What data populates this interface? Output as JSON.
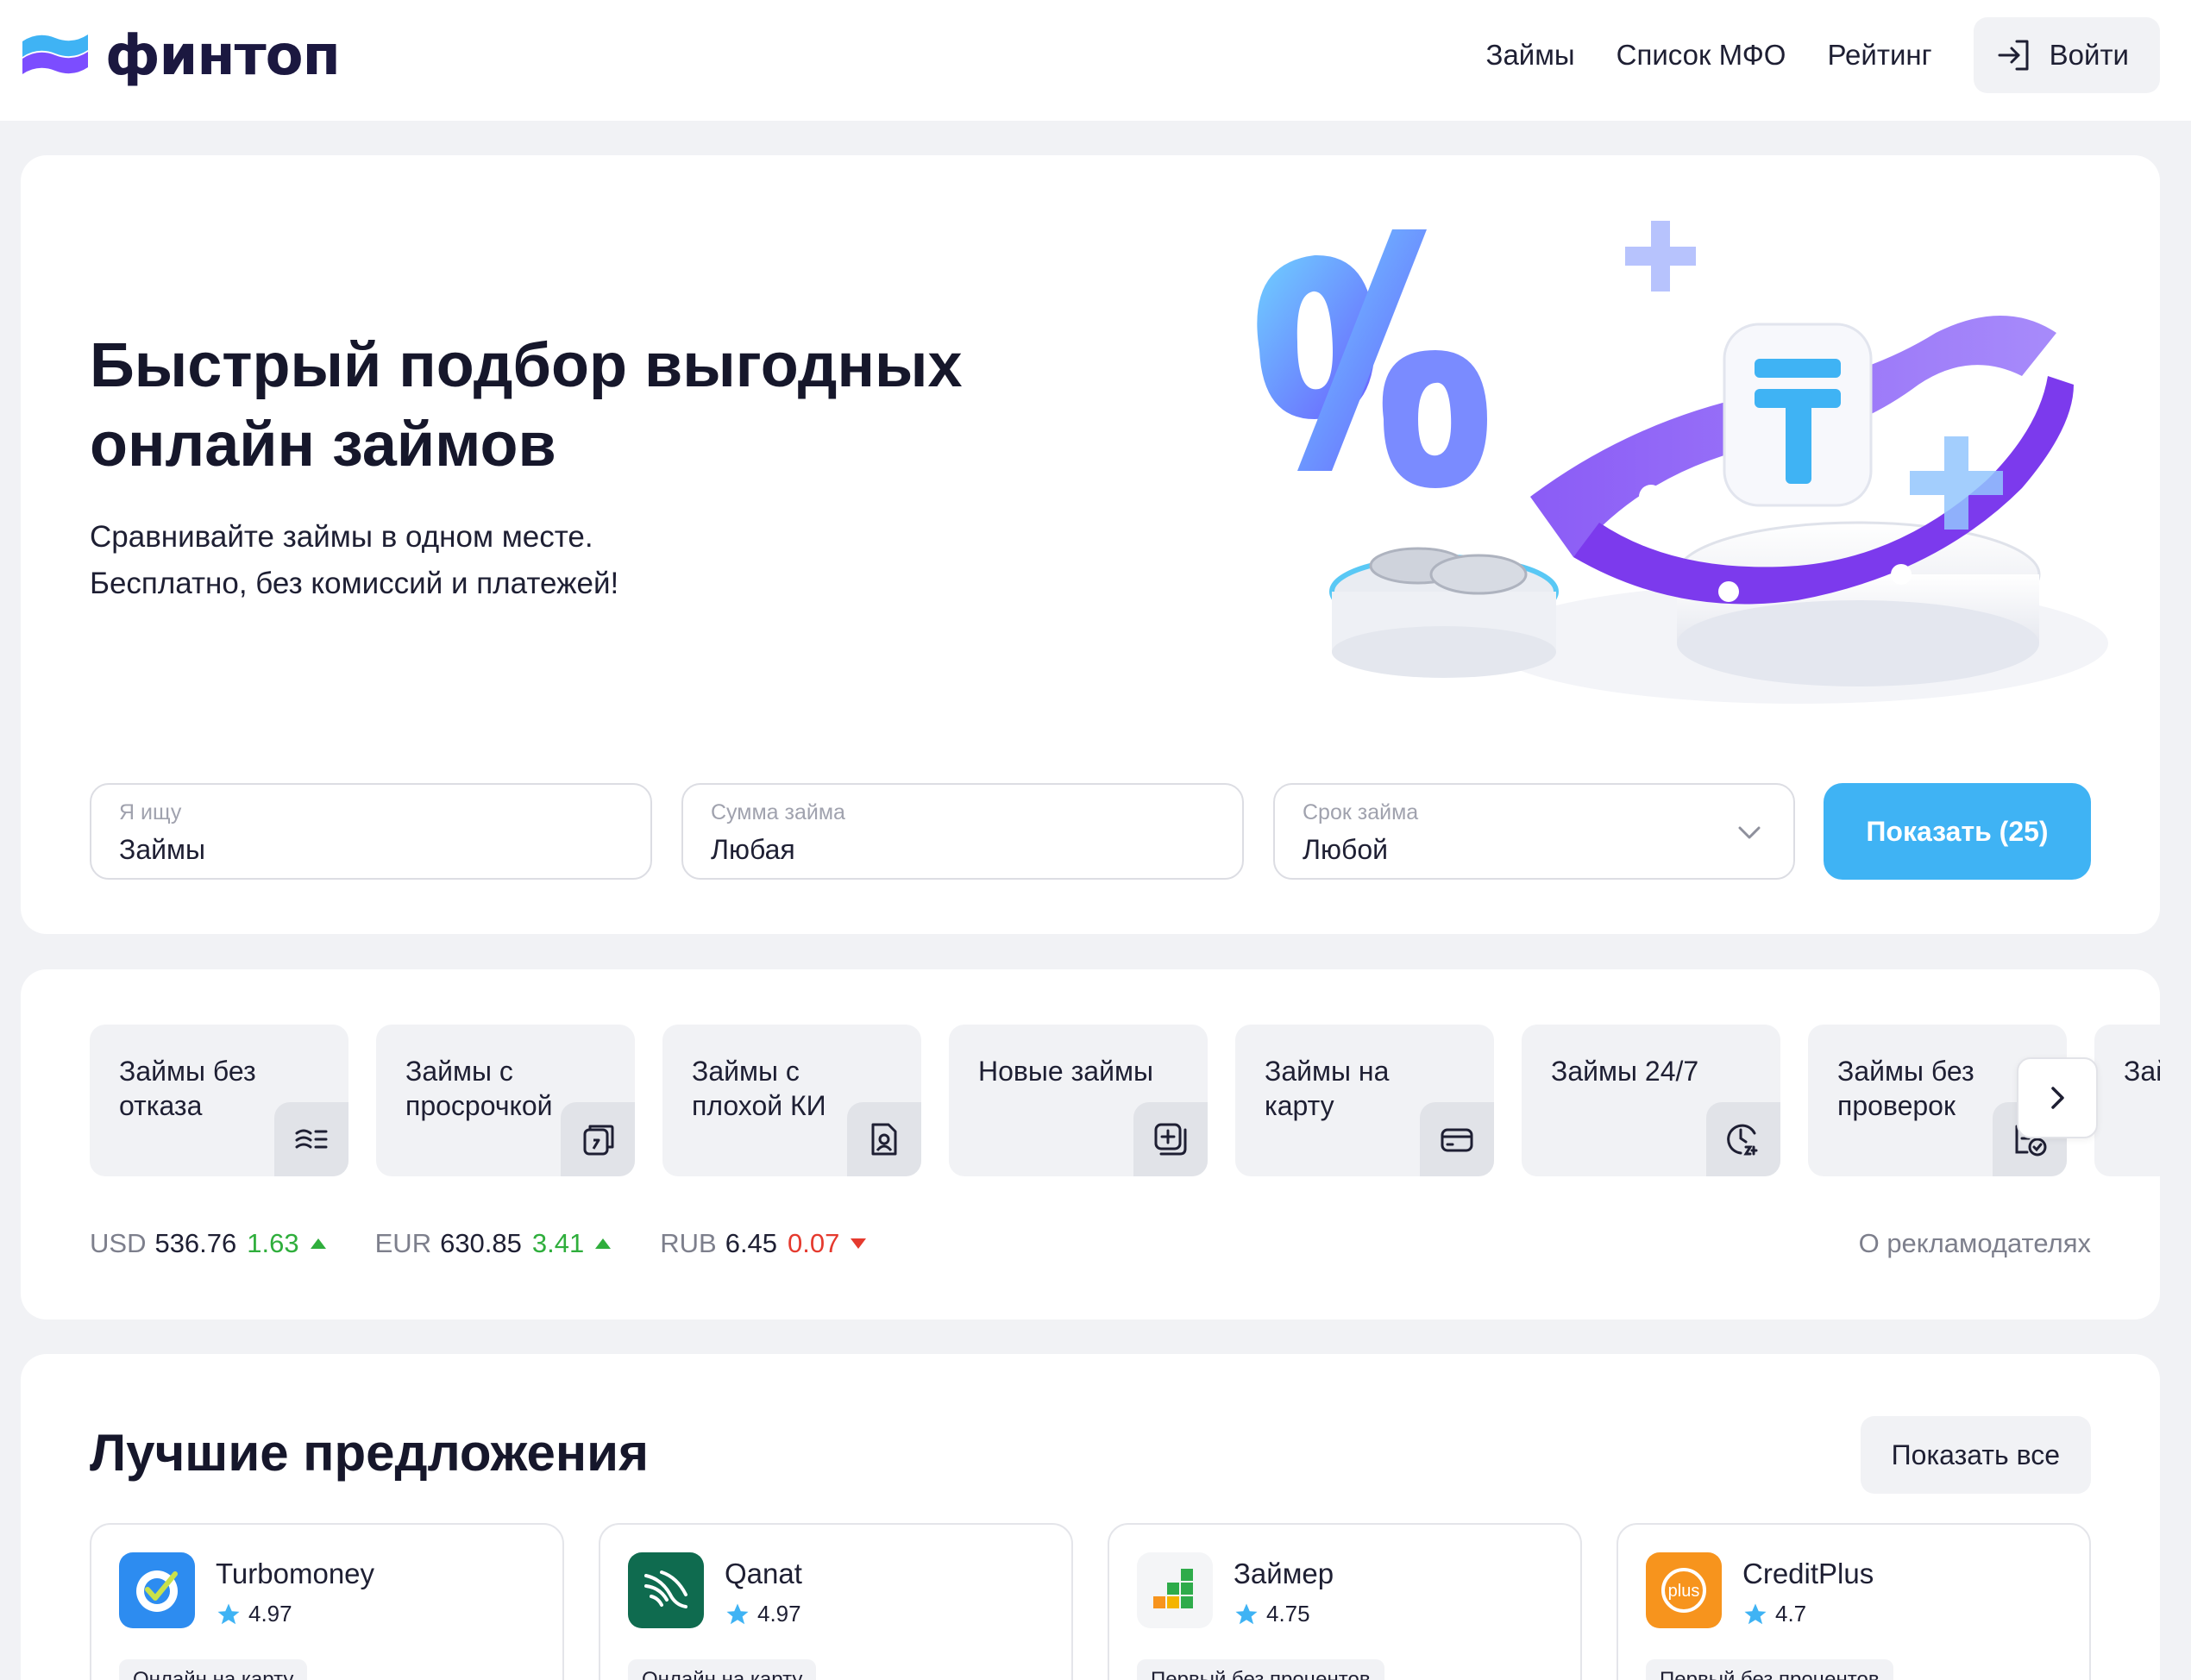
{
  "brand": {
    "name": "финтоп",
    "accent": "#3fb3f4",
    "logo_colors": [
      "#3fb3f4",
      "#7c4dff"
    ]
  },
  "nav": {
    "items": [
      "Займы",
      "Список МФО",
      "Рейтинг"
    ],
    "login": "Войти"
  },
  "hero": {
    "title": "Быстрый подбор выгодных онлайн займов",
    "subtitle_line1": "Сравнивайте займы в одном месте.",
    "subtitle_line2": "Бесплатно, без комиссий и платежей!"
  },
  "search": {
    "what": {
      "label": "Я ищу",
      "value": "Займы"
    },
    "amount": {
      "label": "Сумма займа",
      "value": "Любая"
    },
    "term": {
      "label": "Срок займа",
      "value": "Любой"
    },
    "submit": "Показать (25)"
  },
  "categories": [
    {
      "label": "Займы без отказа",
      "icon": "refuse-free-icon"
    },
    {
      "label": "Займы с просрочкой",
      "icon": "calendar-overdue-icon"
    },
    {
      "label": "Займы с плохой КИ",
      "icon": "credit-history-doc-icon"
    },
    {
      "label": "Новые займы",
      "icon": "new-plus-icon"
    },
    {
      "label": "Займы на карту",
      "icon": "card-icon"
    },
    {
      "label": "Займы 24/7",
      "icon": "clock-24-icon"
    },
    {
      "label": "Займы без проверок",
      "icon": "no-check-icon"
    },
    {
      "label": "Займы про",
      "icon": "partial-icon"
    }
  ],
  "rates": [
    {
      "code": "USD",
      "value": "536.76",
      "change": "1.63",
      "direction": "up"
    },
    {
      "code": "EUR",
      "value": "630.85",
      "change": "3.41",
      "direction": "up"
    },
    {
      "code": "RUB",
      "value": "6.45",
      "change": "0.07",
      "direction": "down"
    }
  ],
  "advertisers_link": "О рекламодателях",
  "offers": {
    "title": "Лучшие предложения",
    "show_all": "Показать все",
    "items": [
      {
        "name": "Turbomoney",
        "rating": "4.97",
        "tag": "Онлайн на карту",
        "logo_color": "#2d8cf0"
      },
      {
        "name": "Qanat",
        "rating": "4.97",
        "tag": "Онлайн на карту",
        "logo_color": "#0f6b4f"
      },
      {
        "name": "Займер",
        "rating": "4.75",
        "tag": "Первый без процентов",
        "logo_color": "#f4f5f7"
      },
      {
        "name": "CreditPlus",
        "rating": "4.7",
        "tag": "Первый без процентов",
        "logo_color": "#f7941d"
      }
    ]
  }
}
